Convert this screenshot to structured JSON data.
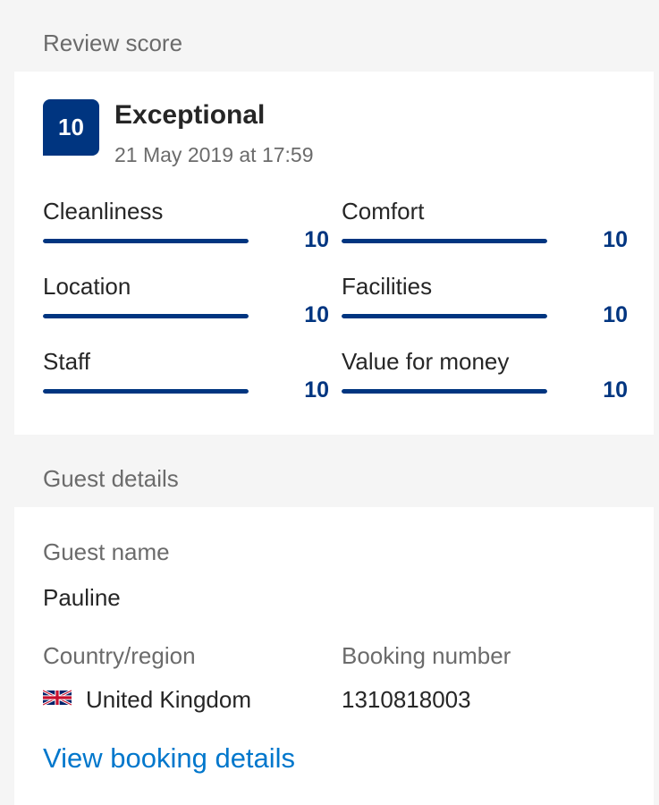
{
  "review_section": {
    "header": "Review score",
    "score": "10",
    "score_fraction": 1.0,
    "rating_word": "Exceptional",
    "date": "21 May 2019 at 17:59",
    "subscores": [
      {
        "label": "Cleanliness",
        "value": "10",
        "fraction": 1.0
      },
      {
        "label": "Comfort",
        "value": "10",
        "fraction": 1.0
      },
      {
        "label": "Location",
        "value": "10",
        "fraction": 1.0
      },
      {
        "label": "Facilities",
        "value": "10",
        "fraction": 1.0
      },
      {
        "label": "Staff",
        "value": "10",
        "fraction": 1.0
      },
      {
        "label": "Value for money",
        "value": "10",
        "fraction": 1.0
      }
    ]
  },
  "guest_section": {
    "header": "Guest details",
    "guest_name_label": "Guest name",
    "guest_name": "Pauline",
    "country_label": "Country/region",
    "country": "United Kingdom",
    "country_flag_icon": "uk-flag-icon",
    "booking_number_label": "Booking number",
    "booking_number": "1310818003",
    "view_booking_link": "View booking details"
  },
  "colors": {
    "brand": "#003580",
    "link": "#0077cc",
    "page_bg": "#f5f5f5",
    "card_bg": "#ffffff",
    "muted_text": "#6b6b6b",
    "primary_text": "#262626"
  }
}
